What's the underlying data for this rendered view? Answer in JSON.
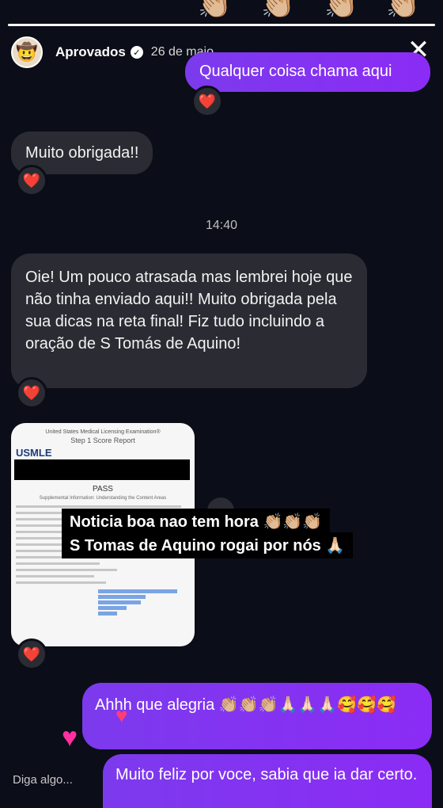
{
  "story": {
    "progress": 1.0
  },
  "header": {
    "avatar_icon": "🤠",
    "username": "Aprovados",
    "verified_icon": "✓",
    "date": "26 de maio",
    "close_icon": "✕"
  },
  "messages": {
    "m1_out": "Qualquer coisa chama aqui",
    "m2_in": "Muito obrigada!!",
    "timestamp": "14:40",
    "m3_in": "Oie! Um pouco atrasada mas lembrei hoje que não tinha enviado aqui!! Muito obrigada pela sua dicas na reta final! Fiz tudo incluindo a oração de S Tomás de Aquino!",
    "m4_out": "Ahhh que alegria 👏🏼👏🏼👏🏼🙏🏻🙏🏻🙏🏻🥰🥰🥰",
    "m5_out": "Muito feliz por voce, sabia que ia dar certo."
  },
  "reaction": {
    "heart_icon": "❤️"
  },
  "document": {
    "header": "United States Medical Licensing Examination®",
    "subheader": "Step 1 Score Report",
    "logo": "USMLE",
    "result": "PASS",
    "section_title": "Supplemental Information: Understanding the Content Areas"
  },
  "sticker": {
    "line1": "Noticia boa nao tem hora 👏🏼👏🏼👏🏼",
    "line2": "S Tomas de Aquino rogai por nós 🙏🏻"
  },
  "footer": {
    "input_placeholder": "Diga algo..."
  },
  "colors": {
    "background": "#0b0d18",
    "incoming_bubble": "#2b2c33",
    "outgoing_bubble": "#7c3aed",
    "heart": "#e0245e"
  }
}
